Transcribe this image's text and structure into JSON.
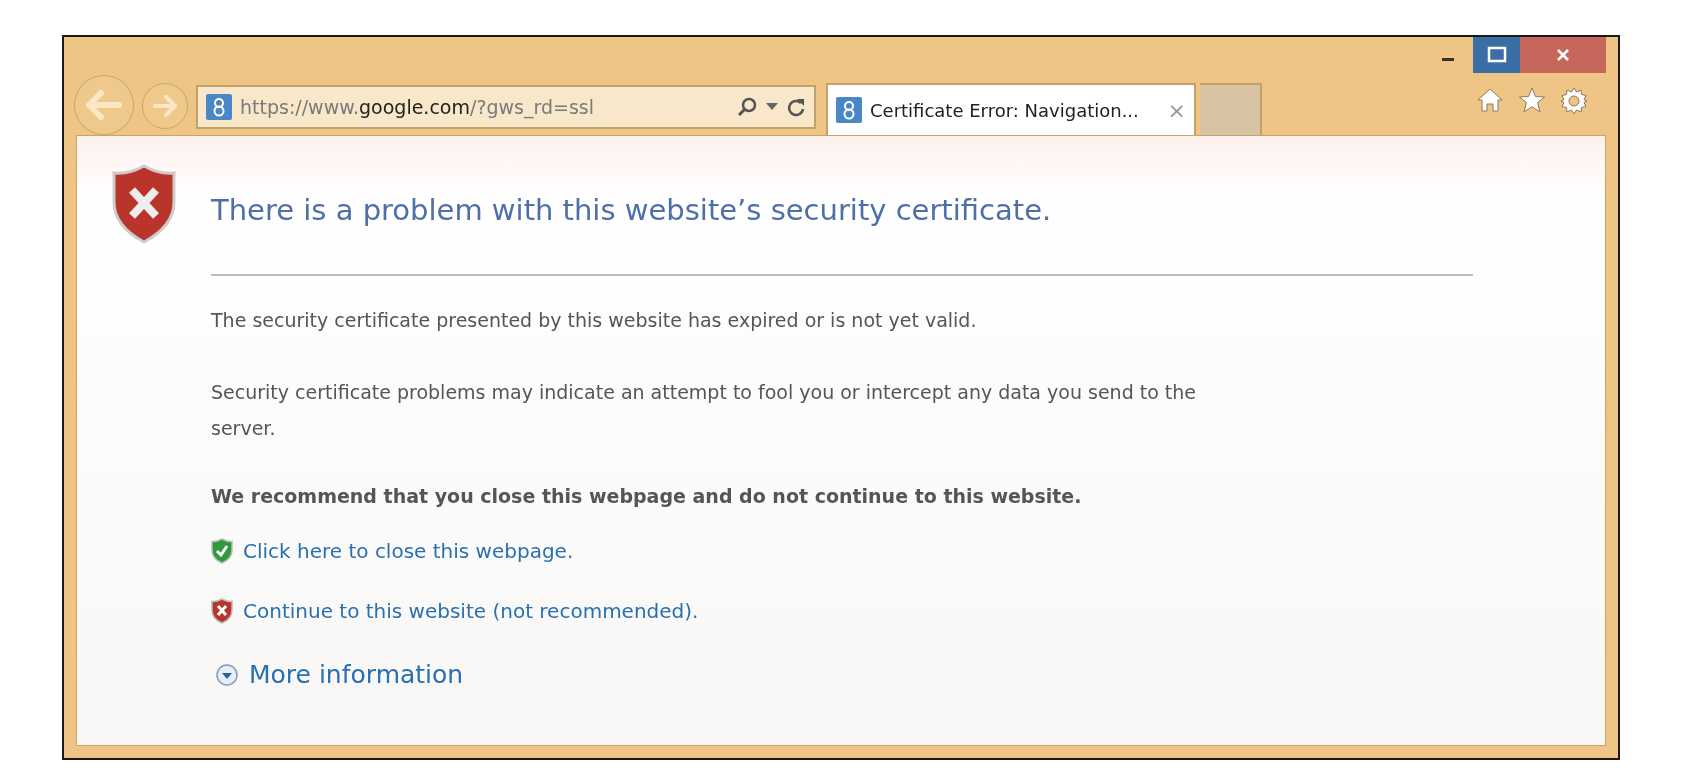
{
  "address_bar": {
    "url_prefix": "https://www.",
    "domain": "google.com",
    "url_suffix": "/?gws_rd=ssl"
  },
  "tabs": [
    {
      "title": "Certificate Error: Navigation...",
      "close": "×",
      "selected": true
    }
  ],
  "page": {
    "heading": "There is a problem with this website’s security certificate.",
    "paragraphs": [
      "The security certificate presented by this website has expired or is not yet valid.",
      "Security certificate problems may indicate an attempt to fool you or intercept any data you send to the server."
    ],
    "recommendation": "We recommend that you close this webpage and do not continue to this website.",
    "links": [
      {
        "kind": "safe",
        "text": "Click here to close this webpage."
      },
      {
        "kind": "unsafe",
        "text": "Continue to this website (not recommended)."
      }
    ],
    "more_information": {
      "text": "More information",
      "expanded": false
    }
  }
}
